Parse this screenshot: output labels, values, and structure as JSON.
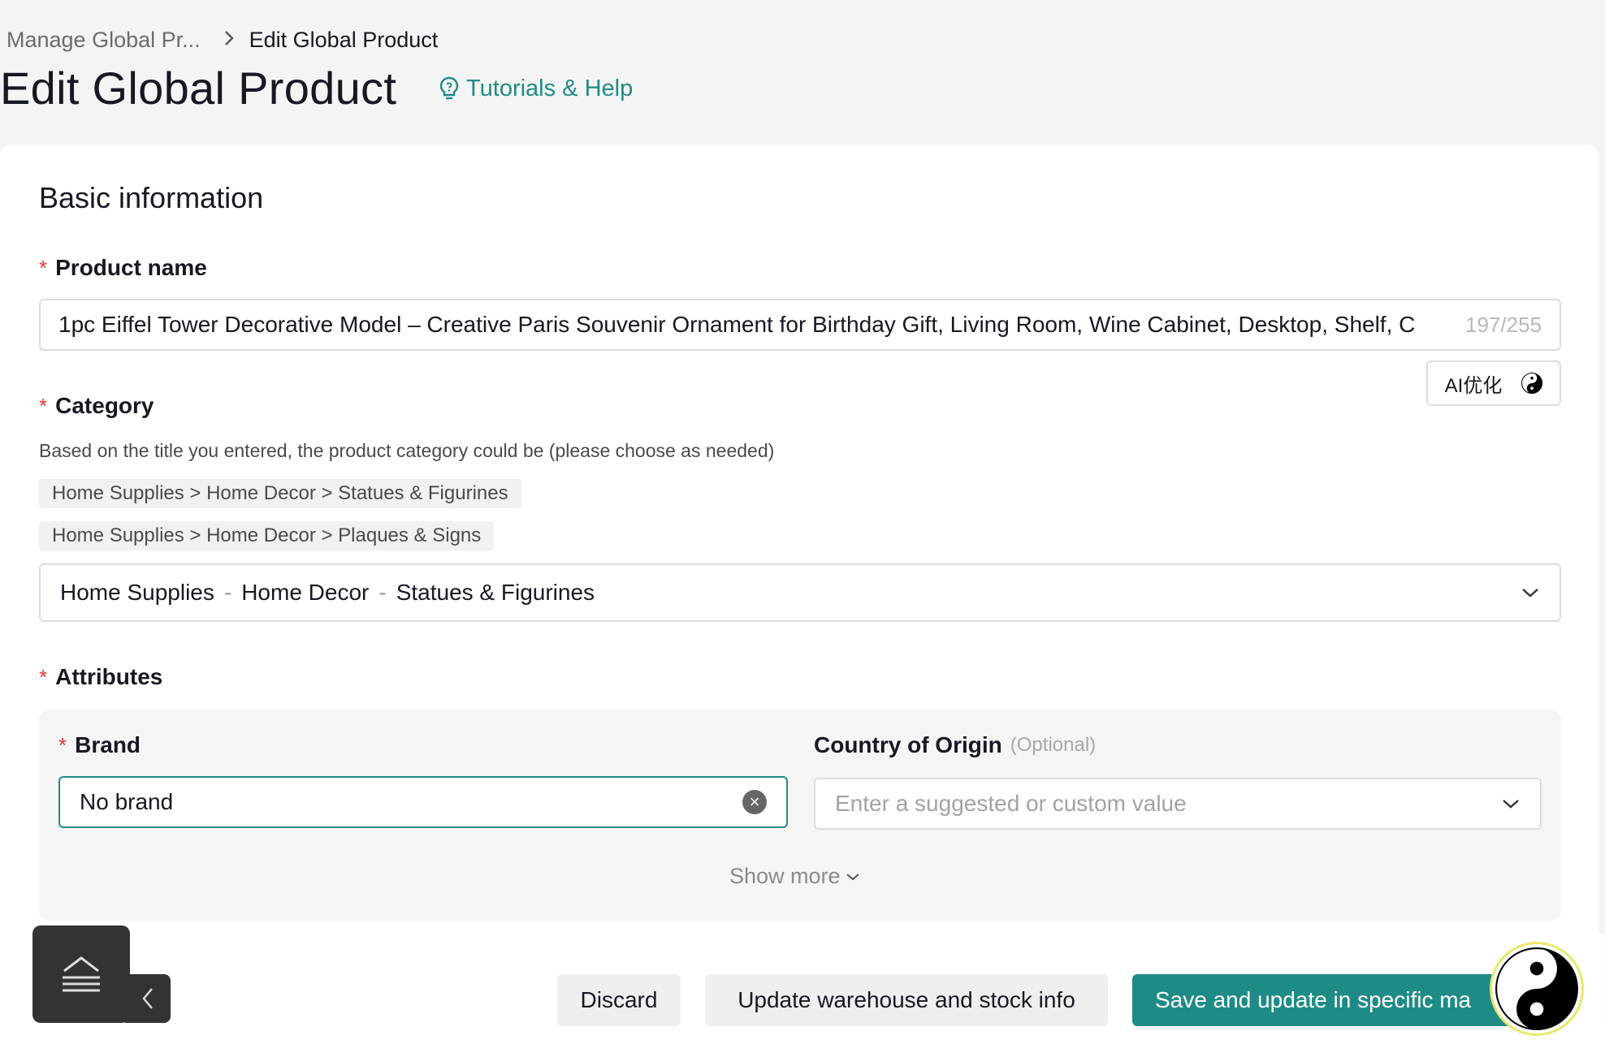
{
  "breadcrumb": {
    "parent": "Manage Global Pr...",
    "current": "Edit Global Product"
  },
  "page": {
    "title": "Edit Global Product",
    "help_link": "Tutorials & Help"
  },
  "basic_info": {
    "section_title": "Basic information",
    "product_name": {
      "label": "Product name",
      "value": "1pc Eiffel Tower Decorative Model – Creative Paris Souvenir Ornament for Birthday Gift, Living Room, Wine Cabinet, Desktop, Shelf, C",
      "counter": "197/255"
    },
    "ai_button": {
      "label": "AI优化",
      "icon": "yinyang-icon"
    },
    "category": {
      "label": "Category",
      "hint": "Based on the title you entered, the product category could be (please choose as needed)",
      "suggestions": [
        "Home Supplies > Home Decor > Statues & Figurines",
        "Home Supplies > Home Decor > Plaques & Signs"
      ],
      "selected": [
        "Home Supplies",
        "Home Decor",
        "Statues & Figurines"
      ],
      "separator": "-"
    },
    "attributes": {
      "label": "Attributes",
      "brand": {
        "label": "Brand",
        "value": "No brand"
      },
      "country_of_origin": {
        "label": "Country of Origin",
        "optional_tag": "(Optional)",
        "placeholder": "Enter a suggested or custom value"
      },
      "show_more": "Show more"
    }
  },
  "actions": {
    "discard": "Discard",
    "update_warehouse": "Update warehouse and stock info",
    "save": "Save and update in specific ma"
  },
  "colors": {
    "accent": "#1f8b87",
    "required": "#e53935",
    "background": "#f4f4f4"
  }
}
